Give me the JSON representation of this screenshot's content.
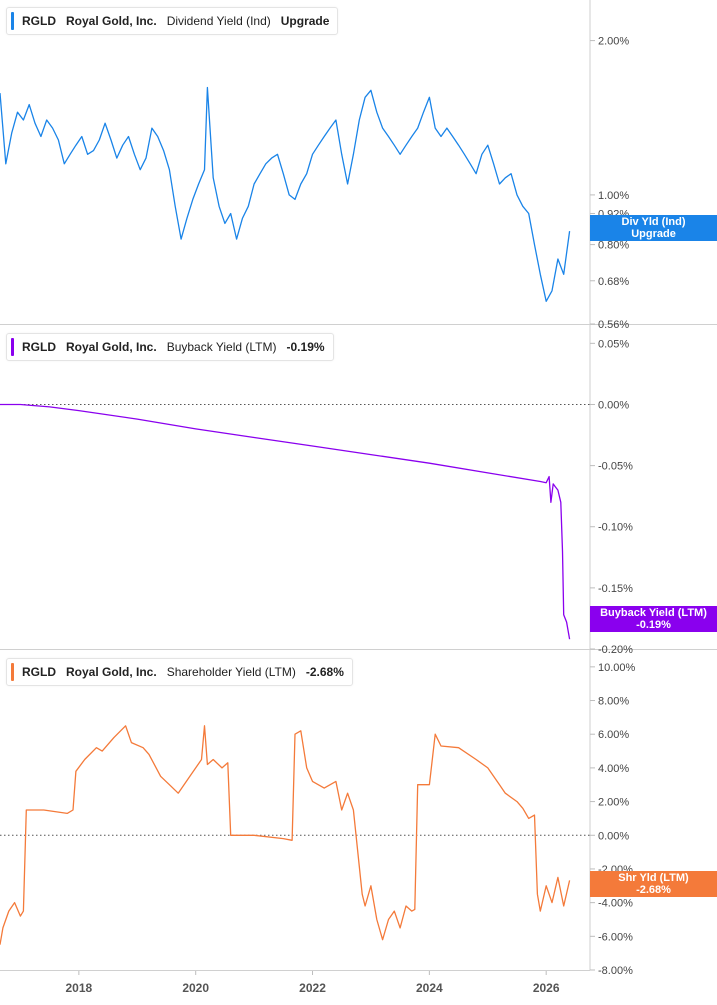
{
  "x_axis": {
    "labels": [
      "2018",
      "2020",
      "2022",
      "2024",
      "2026"
    ]
  },
  "panels": [
    {
      "ticker": "RGLD",
      "company": "Royal Gold, Inc.",
      "metric": "Dividend Yield (Ind)",
      "value": "Upgrade",
      "color": "#1a84e8",
      "tag_line1": "Div Yld (Ind)",
      "tag_line2": "Upgrade",
      "tick_labels": [
        "2.00%",
        "1.00%",
        "0.92%",
        "0.80%",
        "0.68%",
        "0.56%"
      ]
    },
    {
      "ticker": "RGLD",
      "company": "Royal Gold, Inc.",
      "metric": "Buyback Yield (LTM)",
      "value": "-0.19%",
      "color": "#8a00ee",
      "tag_line1": "Buyback Yield (LTM)",
      "tag_line2": "-0.19%",
      "tick_labels": [
        "0.05%",
        "0.00%",
        "-0.05%",
        "-0.10%",
        "-0.15%",
        "-0.20%"
      ]
    },
    {
      "ticker": "RGLD",
      "company": "Royal Gold, Inc.",
      "metric": "Shareholder Yield (LTM)",
      "value": "-2.68%",
      "color": "#f47a3a",
      "tag_line1": "Shr Yld (LTM)",
      "tag_line2": "-2.68%",
      "tick_labels": [
        "10.00%",
        "8.00%",
        "6.00%",
        "4.00%",
        "2.00%",
        "0.00%",
        "-2.00%",
        "-4.00%",
        "-6.00%",
        "-8.00%"
      ]
    }
  ],
  "chart_data": [
    {
      "type": "line",
      "title": "RGLD Royal Gold, Inc. Dividend Yield (Ind) Upgrade",
      "yscale": "log",
      "ylim": [
        0.56,
        2.4
      ],
      "y_ticks": [
        2.0,
        1.0,
        0.92,
        0.8,
        0.68,
        0.56
      ],
      "xlim": [
        2016.65,
        2026.75
      ],
      "series": [
        {
          "name": "Dividend Yield (Ind)",
          "color": "#1a84e8",
          "x": [
            2016.65,
            2016.75,
            2016.85,
            2016.95,
            2017.05,
            2017.15,
            2017.25,
            2017.35,
            2017.45,
            2017.55,
            2017.65,
            2017.75,
            2017.85,
            2017.95,
            2018.05,
            2018.15,
            2018.25,
            2018.35,
            2018.45,
            2018.55,
            2018.65,
            2018.75,
            2018.85,
            2018.95,
            2019.05,
            2019.15,
            2019.25,
            2019.35,
            2019.45,
            2019.55,
            2019.65,
            2019.75,
            2019.85,
            2019.95,
            2020.05,
            2020.15,
            2020.2,
            2020.3,
            2020.4,
            2020.5,
            2020.6,
            2020.7,
            2020.8,
            2020.9,
            2021.0,
            2021.1,
            2021.2,
            2021.3,
            2021.4,
            2021.5,
            2021.6,
            2021.7,
            2021.8,
            2021.9,
            2022.0,
            2022.1,
            2022.2,
            2022.3,
            2022.4,
            2022.5,
            2022.6,
            2022.7,
            2022.8,
            2022.9,
            2023.0,
            2023.1,
            2023.2,
            2023.3,
            2023.4,
            2023.5,
            2023.6,
            2023.7,
            2023.8,
            2023.9,
            2024.0,
            2024.1,
            2024.2,
            2024.3,
            2024.4,
            2024.5,
            2024.6,
            2024.7,
            2024.8,
            2024.9,
            2025.0,
            2025.1,
            2025.2,
            2025.3,
            2025.4,
            2025.5,
            2025.6,
            2025.7,
            2025.8,
            2025.9,
            2026.0,
            2026.1,
            2026.2,
            2026.3,
            2026.4
          ],
          "values": [
            1.58,
            1.15,
            1.32,
            1.45,
            1.4,
            1.5,
            1.38,
            1.3,
            1.4,
            1.35,
            1.28,
            1.15,
            1.2,
            1.25,
            1.3,
            1.2,
            1.22,
            1.28,
            1.38,
            1.28,
            1.18,
            1.25,
            1.3,
            1.2,
            1.12,
            1.18,
            1.35,
            1.3,
            1.22,
            1.12,
            0.95,
            0.82,
            0.9,
            0.98,
            1.05,
            1.12,
            1.62,
            1.08,
            0.95,
            0.88,
            0.92,
            0.82,
            0.9,
            0.95,
            1.05,
            1.1,
            1.15,
            1.18,
            1.2,
            1.1,
            1.0,
            0.98,
            1.05,
            1.1,
            1.2,
            1.25,
            1.3,
            1.35,
            1.4,
            1.2,
            1.05,
            1.2,
            1.4,
            1.55,
            1.6,
            1.45,
            1.35,
            1.3,
            1.25,
            1.2,
            1.25,
            1.3,
            1.35,
            1.45,
            1.55,
            1.35,
            1.3,
            1.35,
            1.3,
            1.25,
            1.2,
            1.15,
            1.1,
            1.2,
            1.25,
            1.15,
            1.05,
            1.08,
            1.1,
            1.0,
            0.95,
            0.92,
            0.8,
            0.7,
            0.62,
            0.65,
            0.75,
            0.7,
            0.85
          ]
        }
      ]
    },
    {
      "type": "line",
      "title": "RGLD Royal Gold, Inc. Buyback Yield (LTM) -0.19%",
      "ylim": [
        -0.2,
        0.065
      ],
      "y_ticks": [
        0.05,
        0.0,
        -0.05,
        -0.1,
        -0.15,
        -0.2
      ],
      "reference_line": 0.0,
      "xlim": [
        2016.65,
        2026.75
      ],
      "series": [
        {
          "name": "Buyback Yield (LTM)",
          "color": "#8a00ee",
          "x": [
            2016.65,
            2017.0,
            2017.5,
            2018.0,
            2019.0,
            2020.0,
            2021.0,
            2022.0,
            2023.0,
            2024.0,
            2025.0,
            2025.9,
            2026.0,
            2026.05,
            2026.08,
            2026.12,
            2026.15,
            2026.2,
            2026.25,
            2026.28,
            2026.3,
            2026.35,
            2026.4
          ],
          "values": [
            0.0,
            0.0,
            -0.002,
            -0.005,
            -0.012,
            -0.02,
            -0.027,
            -0.034,
            -0.041,
            -0.048,
            -0.056,
            -0.063,
            -0.064,
            -0.059,
            -0.08,
            -0.065,
            -0.067,
            -0.07,
            -0.08,
            -0.12,
            -0.172,
            -0.178,
            -0.192
          ]
        }
      ]
    },
    {
      "type": "line",
      "title": "RGLD Royal Gold, Inc. Shareholder Yield (LTM) -2.68%",
      "ylim": [
        -8.0,
        11.0
      ],
      "y_ticks": [
        10,
        8,
        6,
        4,
        2,
        0,
        -2,
        -4,
        -6,
        -8
      ],
      "reference_line": 0.0,
      "xlim": [
        2016.65,
        2026.75
      ],
      "series": [
        {
          "name": "Shareholder Yield (LTM)",
          "color": "#f47a3a",
          "x": [
            2016.65,
            2016.7,
            2016.8,
            2016.9,
            2017.0,
            2017.05,
            2017.1,
            2017.4,
            2017.8,
            2017.9,
            2017.95,
            2018.1,
            2018.3,
            2018.4,
            2018.6,
            2018.8,
            2018.9,
            2019.1,
            2019.2,
            2019.4,
            2019.55,
            2019.7,
            2019.9,
            2020.1,
            2020.15,
            2020.2,
            2020.3,
            2020.45,
            2020.55,
            2020.6,
            2021.0,
            2021.5,
            2021.65,
            2021.7,
            2021.8,
            2021.9,
            2022.0,
            2022.2,
            2022.4,
            2022.5,
            2022.6,
            2022.7,
            2022.85,
            2022.9,
            2023.0,
            2023.1,
            2023.2,
            2023.3,
            2023.4,
            2023.5,
            2023.6,
            2023.7,
            2023.75,
            2023.8,
            2024.0,
            2024.1,
            2024.2,
            2024.5,
            2024.8,
            2025.0,
            2025.2,
            2025.3,
            2025.5,
            2025.6,
            2025.7,
            2025.8,
            2025.85,
            2025.9,
            2026.0,
            2026.1,
            2026.2,
            2026.3,
            2026.4
          ],
          "values": [
            -6.5,
            -5.5,
            -4.5,
            -4.0,
            -4.8,
            -4.5,
            1.5,
            1.5,
            1.3,
            1.5,
            3.8,
            4.5,
            5.2,
            5.0,
            5.8,
            6.5,
            5.5,
            5.2,
            4.8,
            3.5,
            3.0,
            2.5,
            3.5,
            4.5,
            6.5,
            4.2,
            4.5,
            4.0,
            4.3,
            0.0,
            0.0,
            -0.2,
            -0.3,
            6.0,
            6.2,
            4.0,
            3.2,
            2.8,
            3.2,
            1.5,
            2.5,
            1.5,
            -3.5,
            -4.2,
            -3.0,
            -5.0,
            -6.2,
            -5.0,
            -4.5,
            -5.5,
            -4.2,
            -4.5,
            -4.4,
            3.0,
            3.0,
            6.0,
            5.3,
            5.2,
            4.5,
            4.0,
            3.0,
            2.5,
            2.0,
            1.6,
            1.0,
            1.2,
            -3.5,
            -4.5,
            -3.0,
            -4.0,
            -2.5,
            -4.2,
            -2.68
          ]
        }
      ]
    }
  ]
}
